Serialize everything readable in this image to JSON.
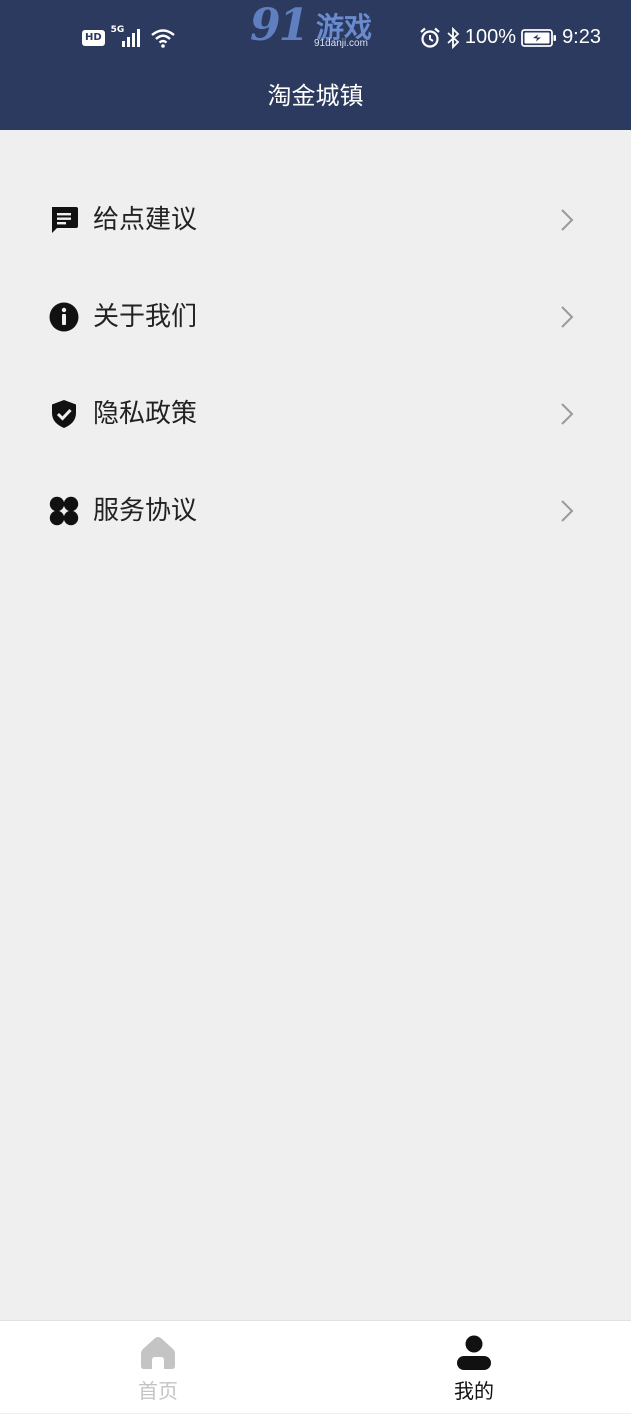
{
  "status_bar": {
    "hd_badge": "HD",
    "network": "5G",
    "battery_percent": "100%",
    "time": "9:23"
  },
  "watermark": {
    "logo_digits": "91",
    "logo_text": "游戏",
    "url": "91danji.com"
  },
  "header": {
    "title": "淘金城镇"
  },
  "menu": {
    "items": [
      {
        "label": "给点建议",
        "icon": "message-icon"
      },
      {
        "label": "关于我们",
        "icon": "info-icon"
      },
      {
        "label": "隐私政策",
        "icon": "shield-check-icon"
      },
      {
        "label": "服务协议",
        "icon": "clover-icon"
      }
    ]
  },
  "tabbar": {
    "tabs": [
      {
        "label": "首页",
        "icon": "home-icon",
        "active": false
      },
      {
        "label": "我的",
        "icon": "user-icon",
        "active": true
      }
    ]
  },
  "colors": {
    "header_bg": "#2b3a5e",
    "page_bg": "#efeff0",
    "active_tab": "#111111",
    "inactive_tab": "#c4c4c4"
  }
}
